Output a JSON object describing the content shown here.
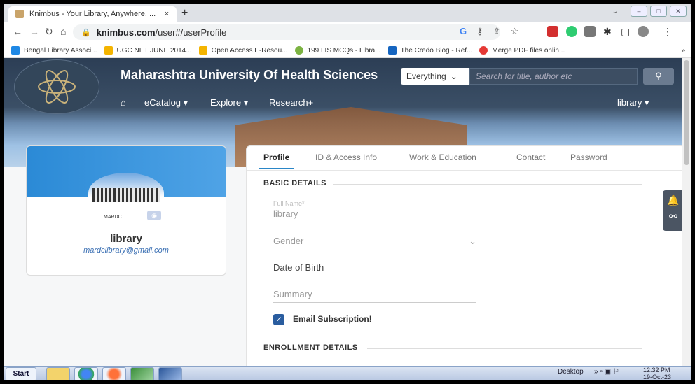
{
  "browser": {
    "tab_title": "Knimbus - Your Library, Anywhere, ...",
    "tab_close": "×",
    "new_tab": "+",
    "url_host": "knimbus.com",
    "url_path": "/user#/userProfile",
    "bookmarks": [
      {
        "label": "Bengal Library Associ...",
        "color": "#1e88e5"
      },
      {
        "label": "UGC NET JUNE 2014...",
        "color": "#f4b400"
      },
      {
        "label": "Open Access E-Resou...",
        "color": "#f4b400"
      },
      {
        "label": "199 LIS MCQs - Libra...",
        "color": "#7cb342"
      },
      {
        "label": "The Credo Blog - Ref...",
        "color": "#1565c0"
      },
      {
        "label": "Merge PDF files onlin...",
        "color": "#e53935"
      }
    ],
    "bookmarks_more": "»"
  },
  "site": {
    "title": "Maharashtra University Of Health Sciences",
    "search_scope": "Everything",
    "search_placeholder": "Search for title, author etc",
    "menu": {
      "ecatalog": "eCatalog ▾",
      "explore": "Explore ▾",
      "research": "Research+",
      "user": "library ▾"
    }
  },
  "profile_card": {
    "caption": "MARDC",
    "name": "library",
    "email": "mardclibrary@gmail.com"
  },
  "profile_tabs": [
    "Profile",
    "ID & Access Info",
    "Work & Education",
    "Contact",
    "Password"
  ],
  "form": {
    "basic_details": "BASIC DETAILS",
    "full_name_label": "Full Name*",
    "full_name_value": "library",
    "gender_placeholder": "Gender",
    "dob_placeholder": "Date of Birth",
    "summary_placeholder": "Summary",
    "email_subscription": "Email Subscription!",
    "enrollment_details": "ENROLLMENT DETAILS"
  },
  "taskbar": {
    "start": "Start",
    "desktop": "Desktop",
    "time": "12:32 PM",
    "date": "19-Oct-23"
  },
  "colors": {
    "banner_dark": "#2c3e55",
    "accent_blue": "#2a86c7",
    "checkbox_blue": "#2a5d9f"
  }
}
